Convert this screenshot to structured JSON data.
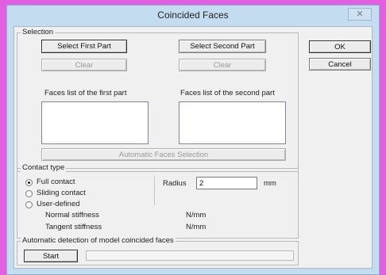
{
  "window": {
    "title": "Coincided Faces",
    "close_glyph": "✕"
  },
  "selection": {
    "group_label": "Selection",
    "select_first_label": "Select First Part",
    "select_second_label": "Select Second Part",
    "clear_first_label": "Clear",
    "clear_second_label": "Clear",
    "list_first_label": "Faces list of the first part",
    "list_second_label": "Faces list of the second part",
    "auto_faces_label": "Automatic Faces Selection"
  },
  "actions": {
    "ok_label": "OK",
    "cancel_label": "Cancel"
  },
  "contact_type": {
    "group_label": "Contact type",
    "full_contact_label": "Full contact",
    "sliding_contact_label": "Sliding contact",
    "user_defined_label": "User-defined",
    "selected": "full_contact",
    "radius_label": "Radius",
    "radius_value": "2",
    "radius_unit": "mm",
    "normal_stiffness_label": "Normal stiffness",
    "normal_stiffness_unit": "N/mm",
    "tangent_stiffness_label": "Tangent stiffness",
    "tangent_stiffness_unit": "N/mm"
  },
  "auto_detect": {
    "group_label": "Automatic detection of model coincided faces",
    "start_label": "Start",
    "progress": 0
  }
}
